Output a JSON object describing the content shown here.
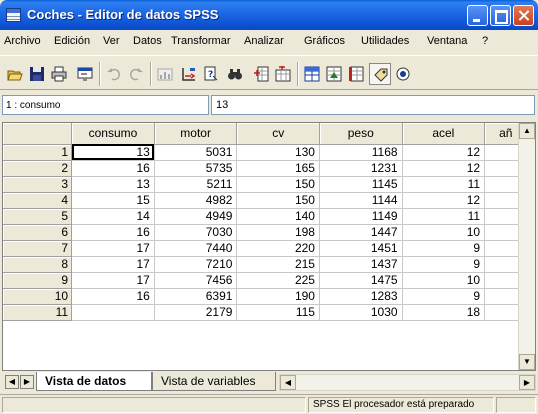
{
  "window": {
    "title": "Coches - Editor de datos SPSS"
  },
  "menu": [
    {
      "label": "Archivo"
    },
    {
      "label": "Edición"
    },
    {
      "label": "Ver"
    },
    {
      "label": "Datos"
    },
    {
      "label": "Transformar"
    },
    {
      "label": "Analizar"
    },
    {
      "label": "Gráficos"
    },
    {
      "label": "Utilidades"
    },
    {
      "label": "Ventana"
    },
    {
      "label": "?"
    }
  ],
  "toolbar": {
    "icons": [
      "open-icon",
      "save-icon",
      "print-icon",
      "dialog-recall-icon",
      "undo-icon",
      "redo-icon",
      "goto-chart-icon",
      "goto-case-icon",
      "variables-icon",
      "find-icon",
      "insert-case-icon",
      "insert-variable-icon",
      "split-file-icon",
      "weight-cases-icon",
      "select-cases-icon",
      "value-labels-icon",
      "use-sets-icon"
    ]
  },
  "cell_editor": {
    "cell_name": "1 : consumo",
    "cell_value": "13"
  },
  "grid": {
    "columns": [
      "consumo",
      "motor",
      "cv",
      "peso",
      "acel",
      "añ"
    ],
    "rows": [
      {
        "n": "1",
        "cells": [
          "13",
          "5031",
          "130",
          "1168",
          "12",
          ""
        ]
      },
      {
        "n": "2",
        "cells": [
          "16",
          "5735",
          "165",
          "1231",
          "12",
          ""
        ]
      },
      {
        "n": "3",
        "cells": [
          "13",
          "5211",
          "150",
          "1145",
          "11",
          ""
        ]
      },
      {
        "n": "4",
        "cells": [
          "15",
          "4982",
          "150",
          "1144",
          "12",
          ""
        ]
      },
      {
        "n": "5",
        "cells": [
          "14",
          "4949",
          "140",
          "1149",
          "11",
          ""
        ]
      },
      {
        "n": "6",
        "cells": [
          "16",
          "7030",
          "198",
          "1447",
          "10",
          ""
        ]
      },
      {
        "n": "7",
        "cells": [
          "17",
          "7440",
          "220",
          "1451",
          "9",
          ""
        ]
      },
      {
        "n": "8",
        "cells": [
          "17",
          "7210",
          "215",
          "1437",
          "9",
          ""
        ]
      },
      {
        "n": "9",
        "cells": [
          "17",
          "7456",
          "225",
          "1475",
          "10",
          ""
        ]
      },
      {
        "n": "10",
        "cells": [
          "16",
          "6391",
          "190",
          "1283",
          "9",
          ""
        ]
      },
      {
        "n": "11",
        "cells": [
          "",
          "2179",
          "115",
          "1030",
          "18",
          ""
        ]
      }
    ]
  },
  "tabs": [
    {
      "label": "Vista de datos",
      "active": true
    },
    {
      "label": "Vista de variables",
      "active": false
    }
  ],
  "status": {
    "message": "SPSS El procesador  está preparado"
  }
}
